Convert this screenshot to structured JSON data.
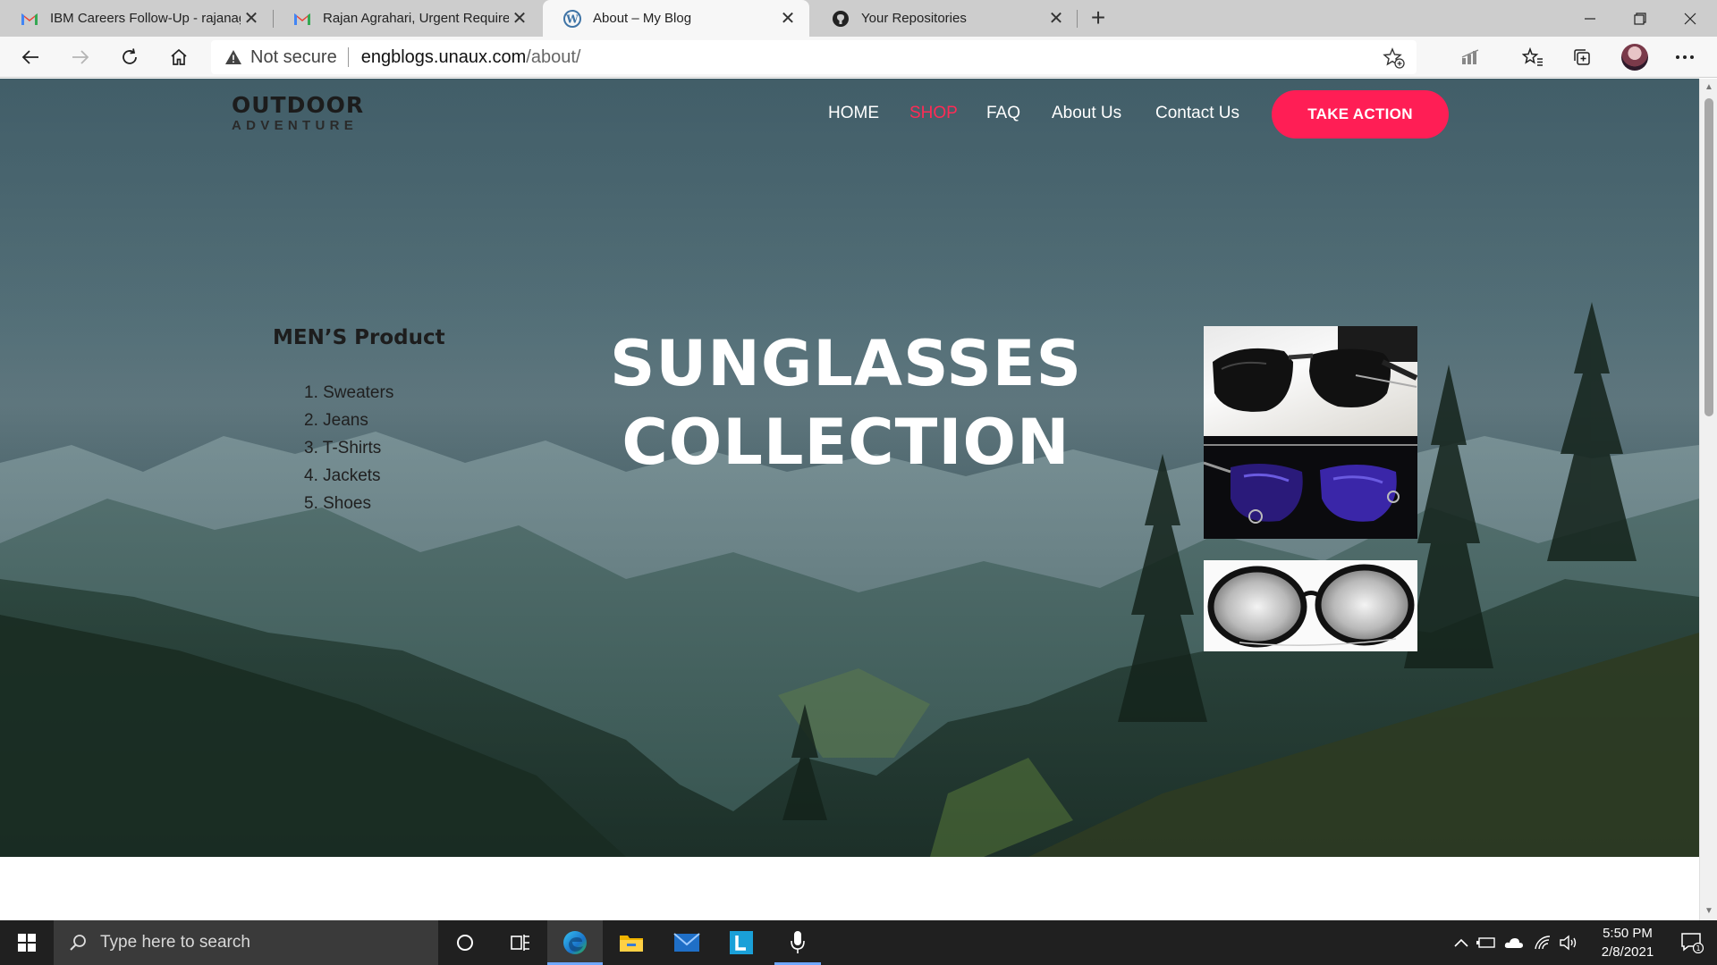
{
  "browser": {
    "tabs": [
      {
        "title": "IBM Careers Follow-Up - rajanag",
        "favicon": "gmail-icon",
        "active": false
      },
      {
        "title": "Rajan Agrahari, Urgent Requirem",
        "favicon": "gmail-icon",
        "active": false
      },
      {
        "title": "About – My Blog",
        "favicon": "wordpress-icon",
        "active": true
      },
      {
        "title": "Your Repositories",
        "favicon": "github-icon",
        "active": false
      }
    ],
    "security_label": "Not secure",
    "url_host": "engblogs.unaux.com",
    "url_path": "/about/"
  },
  "site": {
    "logo_top": "OUTDOOR",
    "logo_bottom": "ADVENTURE",
    "nav": [
      "HOME",
      "SHOP",
      "FAQ",
      "About Us",
      "Contact Us"
    ],
    "nav_active": "SHOP",
    "cta_label": "TAKE ACTION",
    "sidebar_heading": "MEN’S Product",
    "sidebar_items": [
      "1. Sweaters",
      "2. Jeans",
      "3. T-Shirts",
      "4. Jackets",
      "5. Shoes"
    ],
    "hero_title_line1": "SUNGLASSES",
    "hero_title_line2": "COLLECTION",
    "product_images": [
      "black-aviator-sunglasses-image",
      "blue-lens-sunglasses-image",
      "round-mirror-sunglasses-image"
    ]
  },
  "taskbar": {
    "search_placeholder": "Type here to search",
    "time": "5:50 PM",
    "date": "2/8/2021",
    "notification_count": "1"
  },
  "colors": {
    "accent": "#ff1e55",
    "nav_active": "#ff2b55",
    "taskbar": "#202020"
  }
}
